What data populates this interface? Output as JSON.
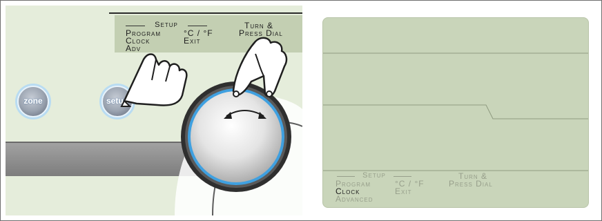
{
  "left_panel": {
    "setup_header": "Setup",
    "program": "Program",
    "unit": "°C / °F",
    "clock": "Clock",
    "exit": "Exit",
    "advanced": "Adv",
    "turn": "Turn &",
    "press_dial": "Press Dial",
    "zone_button": "zone",
    "setup_button": "setup",
    "icons": [
      "pointing-hand-icon",
      "pinching-hand-icon",
      "rotate-arrow-icon"
    ]
  },
  "lcd_panel": {
    "setup_header": "Setup",
    "program": "Program",
    "unit": "°C / °F",
    "clock": "Clock",
    "exit": "Exit",
    "advanced": "Advanced",
    "turn": "Turn &",
    "press_dial": "Press Dial",
    "highlighted_item": "Clock"
  },
  "colors": {
    "panel_bg": "#e3ecd9",
    "lcd_bg": "#c9d5ba",
    "button_glow": "#4aa3e0",
    "dial_ring": "#3a3a3a",
    "gray_bar": "#9a9a9a"
  }
}
